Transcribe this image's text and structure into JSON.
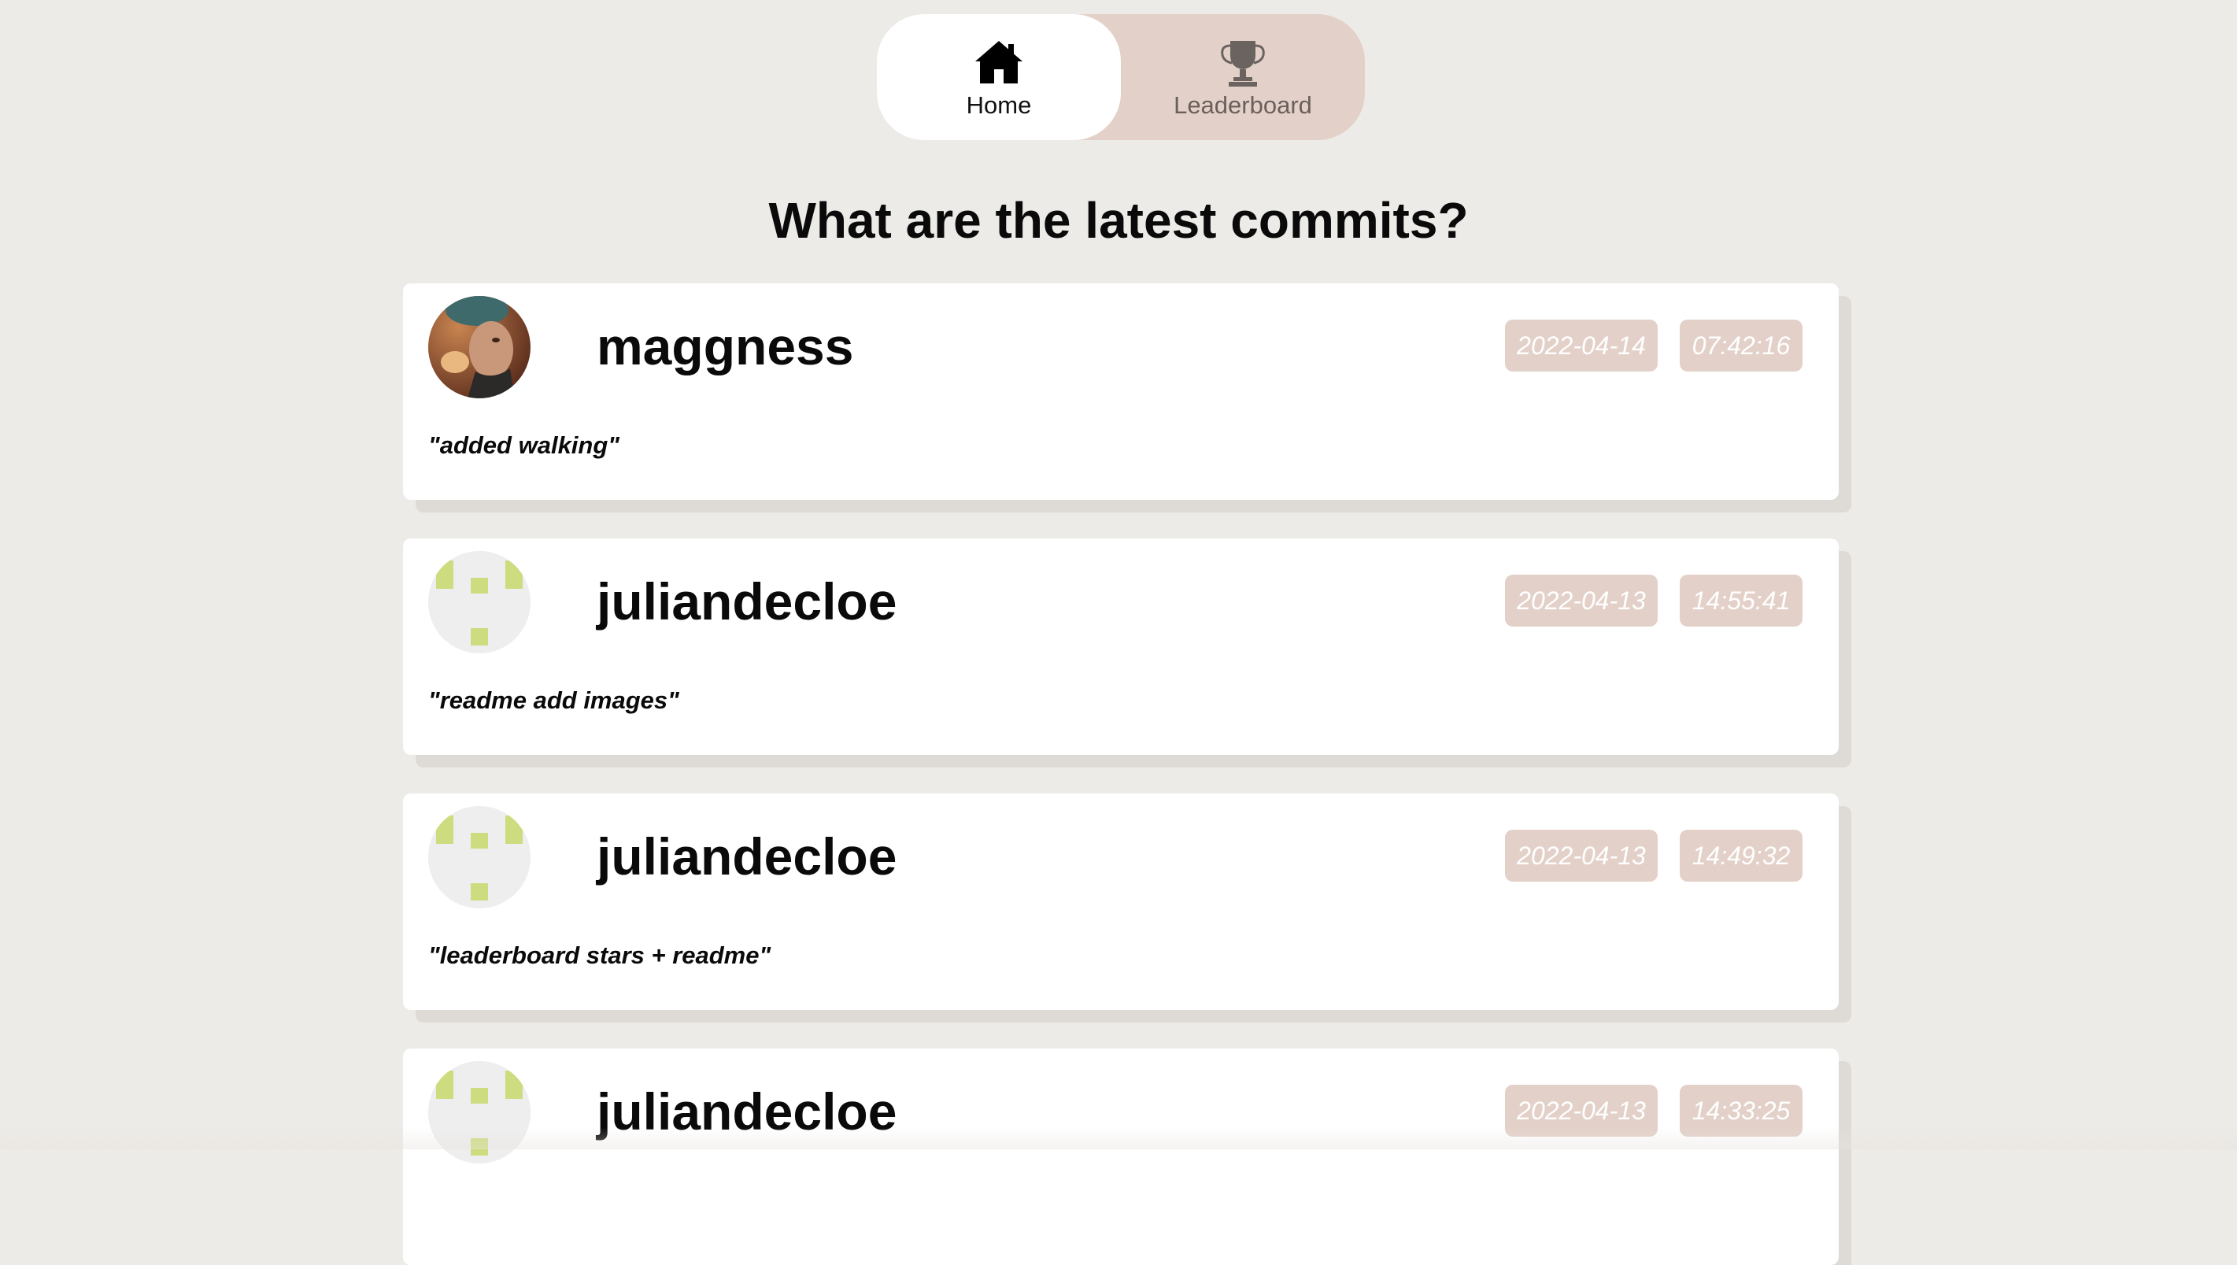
{
  "nav": {
    "items": [
      {
        "label": "Home",
        "icon": "home-icon",
        "active": true
      },
      {
        "label": "Leaderboard",
        "icon": "trophy-icon",
        "active": false
      }
    ]
  },
  "page": {
    "title": "What are the latest commits?"
  },
  "commits": [
    {
      "user": "maggness",
      "avatar": "photo",
      "date": "2022-04-14",
      "time": "07:42:16",
      "message": "\"added walking\""
    },
    {
      "user": "juliandecloe",
      "avatar": "identicon",
      "date": "2022-04-13",
      "time": "14:55:41",
      "message": "\"readme add images\""
    },
    {
      "user": "juliandecloe",
      "avatar": "identicon",
      "date": "2022-04-13",
      "time": "14:49:32",
      "message": "\"leaderboard stars + readme\""
    },
    {
      "user": "juliandecloe",
      "avatar": "identicon",
      "date": "2022-04-13",
      "time": "14:33:25",
      "message": ""
    }
  ],
  "colors": {
    "background": "#edebe7",
    "card": "#ffffff",
    "badge": "#e3d1c9",
    "identicon": "#cddc7e"
  }
}
